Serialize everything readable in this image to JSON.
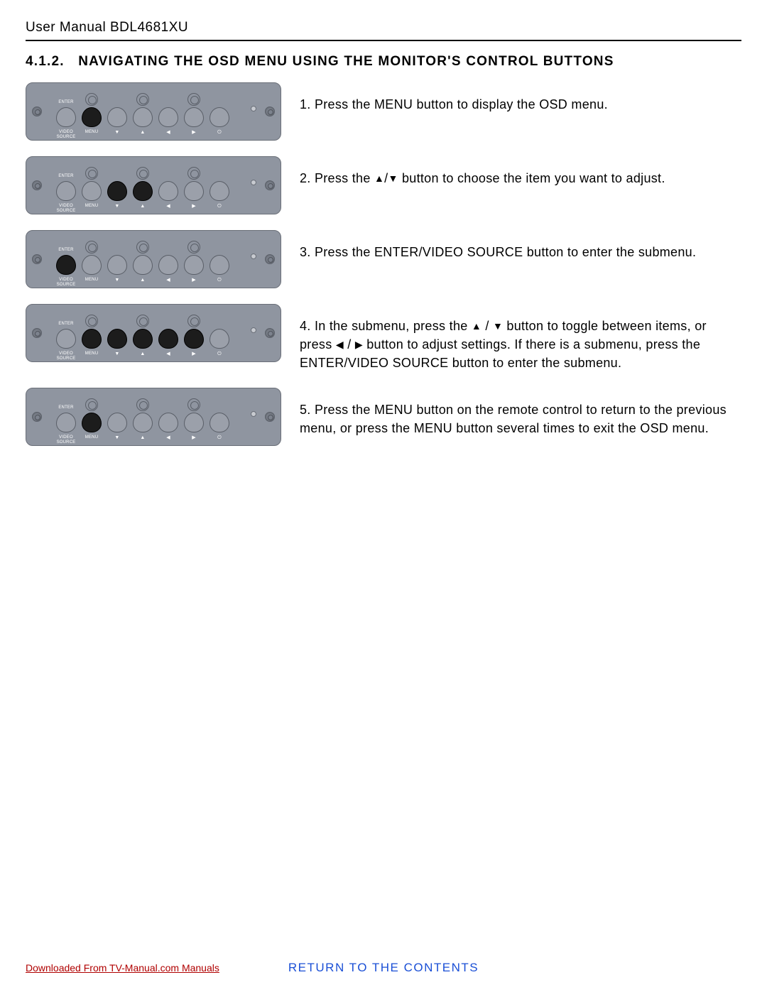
{
  "header": {
    "title": "User Manual BDL4681XU"
  },
  "section": {
    "number": "4.1.2.",
    "title": "NAVIGATING THE OSD MENU USING THE MONITOR'S CONTROL BUTTONS"
  },
  "steps": [
    {
      "num": "1.",
      "parts": [
        "Press the ",
        "MENU",
        " button to display the OSD menu."
      ]
    },
    {
      "num": "2.",
      "parts": [
        "Press the ",
        "▲",
        "/",
        "▼",
        " button to choose the item you want to adjust."
      ]
    },
    {
      "num": "3.",
      "parts": [
        "Press the ",
        "ENTER/VIDEO SOURCE",
        " button to enter the submenu."
      ]
    },
    {
      "num": "4.",
      "parts": [
        "In the submenu, press the ",
        "▲",
        " / ",
        "▼",
        " button to toggle between items, or press ",
        "◀",
        " / ",
        "▶",
        " button to adjust settings. If there is a submenu, press the ",
        "ENTER/VIDEO SOURCE",
        " button to enter the submenu."
      ]
    },
    {
      "num": "5.",
      "parts": [
        "Press the ",
        "MENU",
        " button on the remote control to return to the previous menu, or press the ",
        "MENU",
        " button several times to exit the OSD menu."
      ]
    }
  ],
  "panel_labels": {
    "enter": "ENTER",
    "video_source": "VIDEO\nSOURCE",
    "menu": "MENU",
    "down": "▼",
    "up": "▲",
    "left": "◀",
    "right": "▶",
    "power": "⏻"
  },
  "panels_darkmask": [
    [
      false,
      true,
      false,
      false,
      false,
      false,
      false
    ],
    [
      false,
      false,
      true,
      true,
      false,
      false,
      false
    ],
    [
      true,
      false,
      false,
      false,
      false,
      false,
      false
    ],
    [
      false,
      true,
      true,
      true,
      true,
      true,
      false
    ],
    [
      false,
      true,
      false,
      false,
      false,
      false,
      false
    ]
  ],
  "footer": {
    "download": "Downloaded From TV-Manual.com Manuals",
    "return": "RETURN TO THE CONTENTS"
  }
}
